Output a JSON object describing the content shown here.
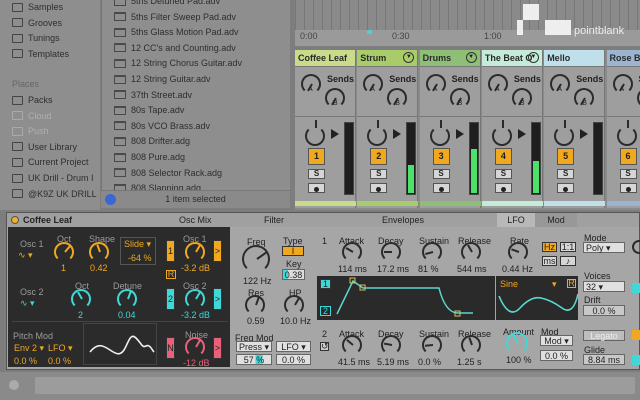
{
  "sidebar": {
    "items": [
      "Samples",
      "Grooves",
      "Tunings",
      "Templates"
    ],
    "places_label": "Places",
    "places": [
      "Packs",
      "Cloud",
      "Push",
      "User Library",
      "Current Project",
      "UK Drill - Drum I",
      "@K9Z UK DRILL"
    ]
  },
  "files": [
    "5ths Detuned Pad.adv",
    "5ths Filter Sweep Pad.adv",
    "5ths Glass Motion Pad.adv",
    "12 CC's and Counting.adv",
    "12 String Chorus Guitar.adv",
    "12 String Guitar.adv",
    "37th Street.adv",
    "80s Tape.adv",
    "80s VCO Brass.adv",
    "808 Drifter.adg",
    "808 Pure.adg",
    "808 Selector Rack.adg",
    "808 Slapping.adg"
  ],
  "status": "1 item selected",
  "timeline": {
    "marks": [
      "0:00",
      "0:30",
      "1:00"
    ]
  },
  "logo": "pointblank",
  "mixer": {
    "sends_label": "Sends",
    "send_a": "A",
    "send_b": "B",
    "solo": "S",
    "tracks": [
      {
        "name": "Coffee Leaf",
        "number": "1",
        "color": "#c9dc8c",
        "level": 0,
        "dropdown": false
      },
      {
        "name": "Strum",
        "number": "2",
        "color": "#a9cc6a",
        "level": 0.4,
        "dropdown": true
      },
      {
        "name": "Drums",
        "number": "3",
        "color": "#8fbe76",
        "level": 0.62,
        "dropdown": true
      },
      {
        "name": "The Beat O",
        "number": "4",
        "color": "#c4ecd8",
        "level": 0.45,
        "dropdown": true
      },
      {
        "name": "Mello",
        "number": "5",
        "color": "#bfe0ea",
        "level": 0,
        "dropdown": false
      },
      {
        "name": "Rose Ba",
        "number": "6",
        "color": "#9cb4d0",
        "level": 0,
        "dropdown": false
      }
    ]
  },
  "device": {
    "title": "Coffee Leaf",
    "sections": {
      "osc_mix": "Osc Mix",
      "filter": "Filter",
      "envelopes": "Envelopes",
      "lfo_tab": "LFO",
      "mod_tab": "Mod"
    },
    "osc1": {
      "label": "Osc 1",
      "oct_label": "Oct",
      "oct": "1",
      "shape_label": "Shape",
      "shape": "0.42",
      "slide": "Slide ▾",
      "slide_val": "-64 %",
      "btn": "1",
      "mix_label": "Osc 1",
      "mix": "-3.2 dB",
      "arrow": ">",
      "r": "R"
    },
    "osc2": {
      "label": "Osc 2",
      "oct_label": "Oct",
      "oct": "2",
      "detune_label": "Detune",
      "detune": "0.04",
      "btn": "2",
      "mix_label": "Osc 2",
      "mix": "-3.2 dB",
      "arrow": ">"
    },
    "pitch": {
      "label": "Pitch Mod",
      "src1": "Env 2 ▾",
      "src2": "LFO ▾",
      "val1": "0.0 %",
      "val2": "0.0 %"
    },
    "noise": {
      "btn": "N",
      "label": "Noise",
      "value": "-12 dB",
      "arrow": ">"
    },
    "filter": {
      "freq_label": "Freq",
      "freq": "122 Hz",
      "type_label": "Type",
      "type": "I",
      "key_label": "Key",
      "key": "0.38",
      "res_label": "Res",
      "res": "0.59",
      "hp_label": "HP",
      "hp": "10.0 Hz",
      "fm_label": "Freq Mod",
      "fm_src1": "Press ▾",
      "fm_src2": "LFO ▾",
      "fm_val1": "57 %",
      "fm_val2": "0.0 %"
    },
    "env1": {
      "num": "1",
      "attack": "114 ms",
      "decay": "17.2 ms",
      "sustain": "81 %",
      "release": "544 ms"
    },
    "env2": {
      "num": "2",
      "attack": "41.5 ms",
      "decay": "5.19 ms",
      "sustain": "0.0 %",
      "release": "1.25 s"
    },
    "env_labels": {
      "attack": "Attack",
      "decay": "Decay",
      "sustain": "Sustain",
      "release": "Release",
      "sel1": "1",
      "sel2": "2"
    },
    "lfo": {
      "rate_label": "Rate",
      "rate": "0.44 Hz",
      "hz": "Hz",
      "sync": "1:1",
      "ms": "ms",
      "note": "♪",
      "wave": "Sine",
      "wave_drop": "▾",
      "r": "R",
      "amount_label": "Amount",
      "amount": "100 %",
      "mod_label": "Mod",
      "mod_src": "Mod ▾",
      "mod_val": "0.0 %"
    },
    "global": {
      "mode_label": "Mode",
      "mode": "Poly ▾",
      "voices_label": "Voices",
      "voices": "32 ▾",
      "drift_label": "Drift",
      "drift": "0.0 %",
      "legato": "Legato",
      "glide_label": "Glide",
      "glide": "8.84 ms"
    }
  }
}
